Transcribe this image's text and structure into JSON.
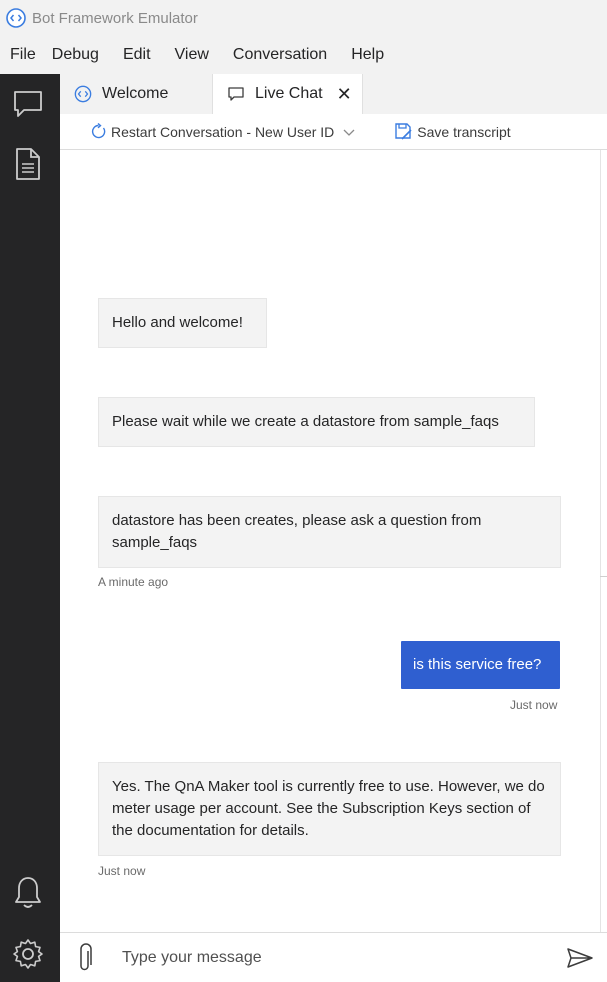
{
  "window": {
    "title": "Bot Framework Emulator",
    "icon": "bot-emulator-icon"
  },
  "menu": [
    "File",
    "Debug",
    "Edit",
    "View",
    "Conversation",
    "Help"
  ],
  "sidebar": {
    "items": [
      "chat-icon",
      "transcript-document-icon"
    ],
    "bottom": [
      "bell-icon",
      "gear-icon"
    ]
  },
  "tabs": [
    {
      "label": "Welcome",
      "icon": "bot-emulator-icon"
    },
    {
      "label": "Live Chat",
      "icon": "chat-icon",
      "active": true
    }
  ],
  "toolbar": {
    "restart_label": "Restart Conversation - New User ID",
    "save_label": "Save transcript"
  },
  "messages": [
    {
      "from": "bot",
      "text": "Hello and welcome!"
    },
    {
      "from": "bot",
      "text": "Please wait while we create a datastore from sample_faqs"
    },
    {
      "from": "bot",
      "text": "datastore has been creates, please ask a question from sample_faqs",
      "timestamp": "A minute ago"
    },
    {
      "from": "user",
      "text": "is this service free?",
      "timestamp": "Just now"
    },
    {
      "from": "bot",
      "text": "Yes. The QnA Maker tool is currently free to use. However, we do meter usage per account. See the Subscription Keys section of the documentation for details.",
      "timestamp": "Just now"
    }
  ],
  "composer": {
    "placeholder": "Type your message"
  },
  "colors": {
    "sidebar": "#252526",
    "user_bubble": "#2f5fd0",
    "bot_bubble": "#f3f3f3"
  }
}
